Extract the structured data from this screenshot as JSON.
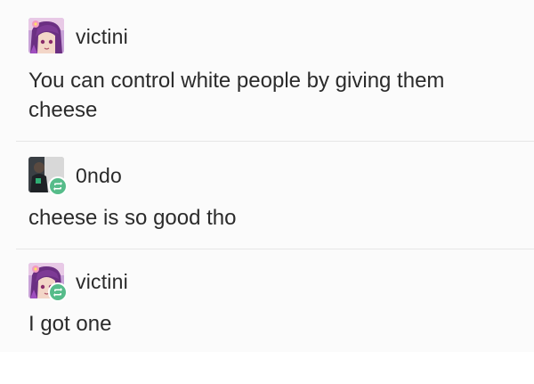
{
  "thread": {
    "posts": [
      {
        "username": "victini",
        "avatar_icon": "anime-avatar-icon",
        "reblogged": false,
        "text": "You can control white people by giving them cheese"
      },
      {
        "username": "0ndo",
        "avatar_icon": "photo-avatar-icon",
        "reblogged": true,
        "text": "cheese is so good tho"
      },
      {
        "username": "victini",
        "avatar_icon": "anime-avatar-icon",
        "reblogged": true,
        "text": "I got one"
      }
    ],
    "colors": {
      "reblog_badge": "#56bc8a",
      "divider": "#e6e6e6",
      "background": "#fbfbfb"
    },
    "badge_icon": "reblog-icon"
  }
}
